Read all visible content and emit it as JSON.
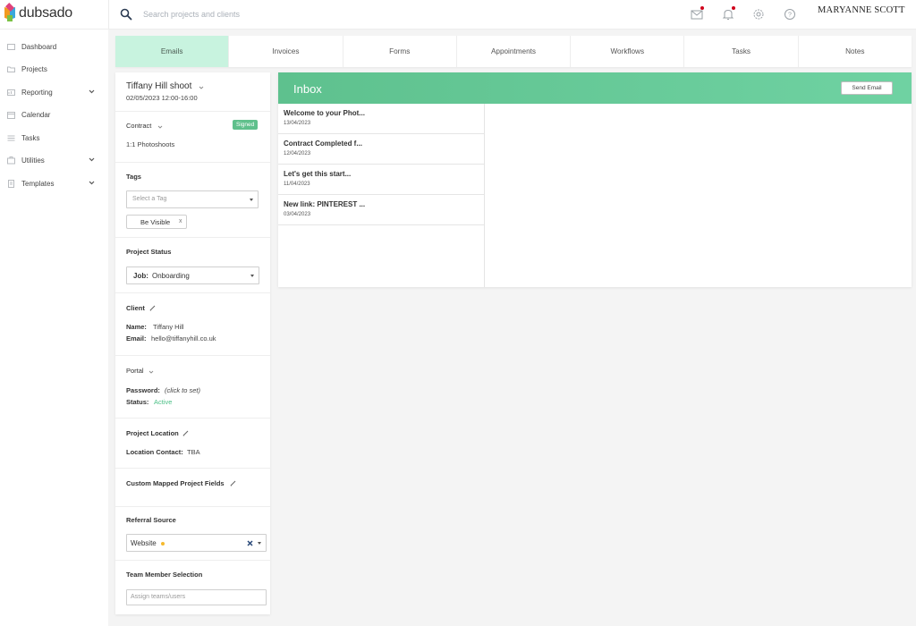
{
  "app": {
    "name": "dubsado"
  },
  "header": {
    "search_placeholder": "Search projects and clients",
    "user_name": "MARYANNE SCOTT",
    "icons": [
      "mail-icon",
      "bell-icon",
      "gear-icon",
      "help-icon"
    ]
  },
  "sidebar": {
    "items": [
      {
        "label": "Dashboard",
        "icon": "dashboard-icon"
      },
      {
        "label": "Projects",
        "icon": "projects-icon"
      },
      {
        "label": "Reporting",
        "icon": "reporting-icon",
        "expandable": true
      },
      {
        "label": "Calendar",
        "icon": "calendar-icon"
      },
      {
        "label": "Tasks",
        "icon": "tasks-icon"
      },
      {
        "label": "Utilities",
        "icon": "utilities-icon",
        "expandable": true
      },
      {
        "label": "Templates",
        "icon": "templates-icon",
        "expandable": true
      }
    ]
  },
  "tabs": [
    "Emails",
    "Invoices",
    "Forms",
    "Appointments",
    "Workflows",
    "Tasks",
    "Notes"
  ],
  "active_tab": "Emails",
  "project": {
    "title": "Tiffany Hill shoot",
    "datetime": "02/05/2023 12:00-16:00",
    "contract_label": "Contract",
    "contract_status": "Signed",
    "contract_name": "1:1 Photoshoots",
    "tags_label": "Tags",
    "tags_placeholder": "Select a Tag",
    "tags": [
      "Be Visible"
    ],
    "tag_remove": "x",
    "status_label": "Project Status",
    "status_prefix": "Job:",
    "status_value": "Onboarding",
    "client_label": "Client",
    "client_name_label": "Name:",
    "client_name": "Tiffany Hill",
    "client_email_label": "Email:",
    "client_email": "hello@tiffanyhill.co.uk",
    "portal_label": "Portal",
    "password_label": "Password:",
    "password_value": "(click to set)",
    "portal_status_label": "Status:",
    "portal_status": "Active",
    "location_label": "Project Location",
    "location_contact_label": "Location Contact:",
    "location_contact": "TBA",
    "custom_fields_label": "Custom Mapped Project Fields",
    "referral_label": "Referral Source",
    "referral_value": "Website",
    "team_label": "Team Member Selection",
    "team_placeholder": "Assign teams/users"
  },
  "inbox": {
    "title": "Inbox",
    "send_button": "Send Email",
    "emails": [
      {
        "subject": "Welcome to your Phot...",
        "date": "13/04/2023"
      },
      {
        "subject": "Contract Completed f...",
        "date": "12/04/2023"
      },
      {
        "subject": "Let's get this start...",
        "date": "11/04/2023"
      },
      {
        "subject": "New link: PINTEREST ...",
        "date": "03/04/2023"
      }
    ]
  },
  "colors": {
    "accent": "#5ec18e",
    "active_tab_bg": "#c8f3df",
    "notification_dot": "#d0021b",
    "status_active": "#4bbf86"
  }
}
